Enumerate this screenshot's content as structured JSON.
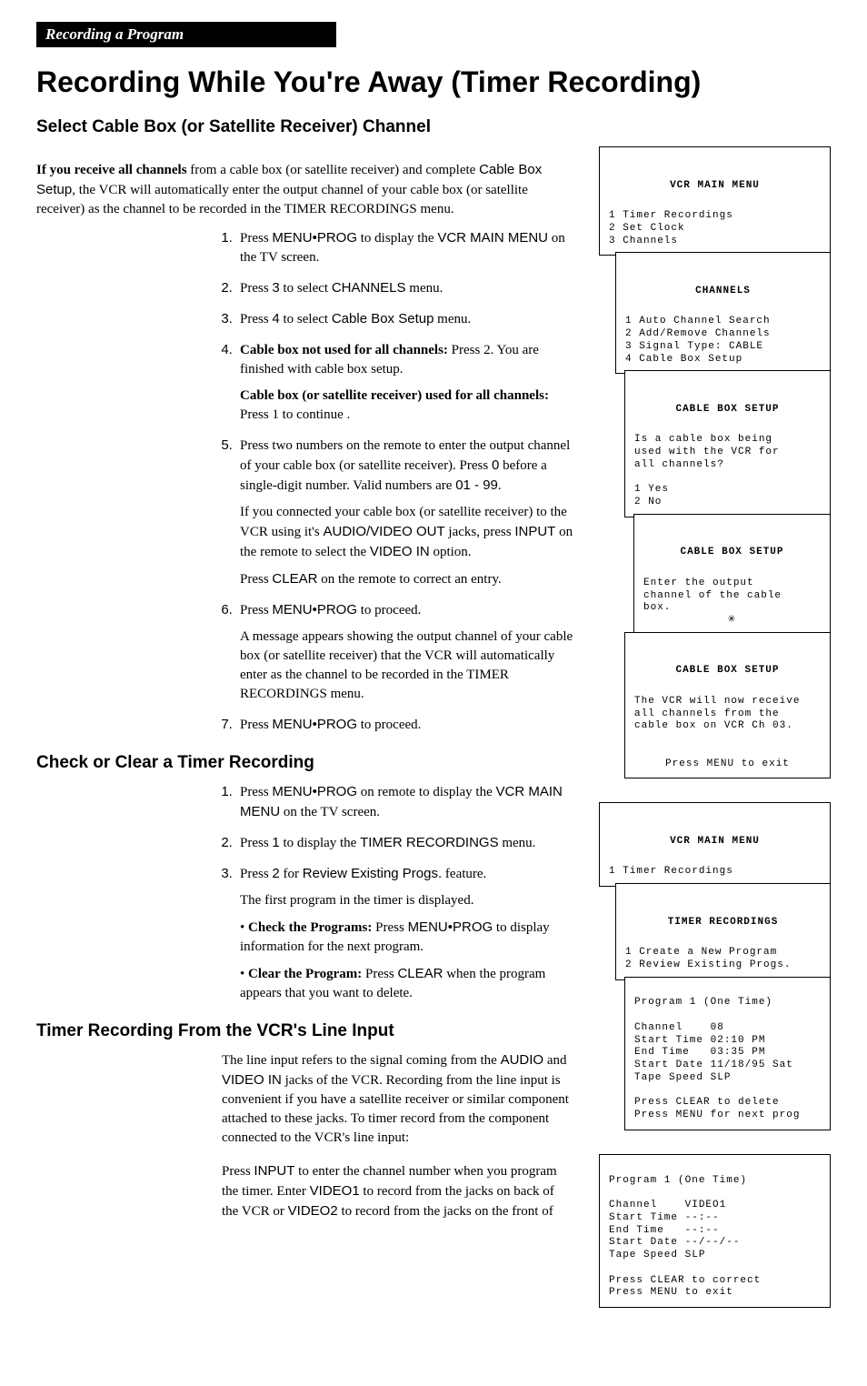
{
  "header_tab": "Recording a Program",
  "page_title": "Recording While You're Away (Timer Recording)",
  "sec1": {
    "heading": "Select Cable Box (or Satellite Receiver) Channel",
    "intro_strong": "If you receive all channels",
    "intro_cont": " from a cable box (or satellite receiver) and complete ",
    "intro_sans": "Cable Box Setup",
    "intro_tail": ", the VCR will automatically enter the output channel of your cable box (or satellite receiver) as the channel to be recorded in the TIMER RECORDINGS menu.",
    "steps": [
      {
        "pre": "Press ",
        "key": "MENU•PROG",
        "mid": " to display the ",
        "key2": "VCR MAIN MENU",
        "tail": " on the TV screen."
      },
      {
        "pre": "Press ",
        "key": "3",
        "mid": " to select ",
        "key2": "CHANNELS",
        "tail": " menu."
      },
      {
        "pre": "Press ",
        "key": "4",
        "mid": " to select ",
        "key2": "Cable Box Setup",
        "tail": " menu."
      },
      {
        "sub": [
          {
            "strong": "Cable box not used for all channels:",
            "t": "  Press 2.  You are finished with cable box setup."
          },
          {
            "strong": "Cable box (or satellite receiver) used for all channels:",
            "t": "  Press 1 to continue ."
          }
        ]
      },
      {
        "pre": "Press two numbers on the remote to enter the output channel of your cable box (or satellite receiver). Press ",
        "key": "0",
        "mid": " before a single-digit number.  Valid numbers are ",
        "key2": "01 - 99",
        "tail": ".",
        "extra": [
          {
            "t": "If you connected your cable box (or satellite receiver) to the VCR using it's ",
            "sans1": "AUDIO/VIDEO OUT",
            "m": " jacks, press ",
            "sans2": "INPUT",
            "m2": " on the remote to select the ",
            "sans3": "VIDEO IN",
            "tail": " option."
          },
          {
            "t": "Press ",
            "sans1": "CLEAR",
            "tail": " on the remote to correct an entry."
          }
        ]
      },
      {
        "pre": "Press ",
        "key": "MENU•PROG",
        "tail": " to proceed.",
        "extra_plain": "A message appears showing the output channel of your cable box (or satellite receiver) that the VCR will automatically enter as the channel to be recorded in the TIMER RECORDINGS menu."
      },
      {
        "pre": "Press ",
        "key": "MENU•PROG",
        "tail": " to proceed."
      }
    ]
  },
  "sec2": {
    "heading": "Check or Clear a Timer Recording",
    "steps": [
      {
        "pre": "Press ",
        "key": "MENU•PROG",
        "mid": " on remote to display the ",
        "key2": "VCR MAIN MENU",
        "tail": " on the TV screen."
      },
      {
        "pre": "Press ",
        "key": "1",
        "mid": " to display the ",
        "key2": "TIMER RECORDINGS",
        "tail": " menu."
      },
      {
        "pre": "Press ",
        "key": "2",
        "mid": " for ",
        "key2": "Review Existing Progs.",
        "tail": " feature.",
        "extra_plain": "The first program in the timer is displayed.",
        "bullets": [
          {
            "strong": "Check the Programs:",
            "t": "  Press ",
            "sans": "MENU•PROG",
            "tail": " to display information for the next program."
          },
          {
            "strong": "Clear the Program:",
            "t": "  Press ",
            "sans": "CLEAR",
            "tail": " when the program appears that you want to delete."
          }
        ]
      }
    ]
  },
  "sec3": {
    "heading": "Timer Recording From the VCR's Line Input",
    "p1": {
      "t": "The line input refers to the signal coming from the ",
      "s1": "AUDIO",
      "m": " and ",
      "s2": "VIDEO IN",
      "tail": " jacks of the VCR.  Recording from the line input is convenient if you have a satellite receiver or similar component attached to these jacks.  To timer record from the component connected to the VCR's line input:"
    },
    "p2": {
      "t": "Press ",
      "s1": "INPUT",
      "m": " to enter the channel number when you program the timer.  Enter ",
      "s2": "VIDEO1",
      "m2": " to record from the jacks on back of the VCR or ",
      "s3": "VIDEO2",
      "tail": " to record from the jacks on the front of"
    }
  },
  "menus": {
    "m1": {
      "title": "VCR MAIN MENU",
      "lines": [
        "1 Timer Recordings",
        "2 Set Clock",
        "3 Channels"
      ]
    },
    "m2": {
      "title": "CHANNELS",
      "lines": [
        "1 Auto Channel Search",
        "2 Add/Remove Channels",
        "3 Signal Type: CABLE",
        "4 Cable Box Setup"
      ]
    },
    "m3": {
      "title": "CABLE BOX SETUP",
      "q": "Is a cable box being\nused with the VCR for\nall channels?",
      "opts": [
        "1 Yes",
        "2 No"
      ]
    },
    "m4": {
      "title": "CABLE BOX SETUP",
      "q": "Enter the output\nchannel of the cable\nbox.",
      "cursor": "✳"
    },
    "m5": {
      "title": "CABLE BOX SETUP",
      "q": "The VCR will now receive\nall channels from the\ncable box on VCR Ch 03.",
      "foot": "Press MENU to exit"
    },
    "m6": {
      "title": "VCR MAIN MENU",
      "lines": [
        "1 Timer Recordings"
      ]
    },
    "m7": {
      "title": "TIMER RECORDINGS",
      "lines": [
        "1 Create a New Program",
        "2 Review Existing Progs."
      ]
    },
    "m8": {
      "title": "Program 1 (One Time)",
      "rows": [
        "Channel    08",
        "Start Time 02:10 PM",
        "End Time   03:35 PM",
        "Start Date 11/18/95 Sat",
        "Tape Speed SLP"
      ],
      "foot": [
        "Press CLEAR to delete",
        "Press MENU for next prog"
      ]
    },
    "m9": {
      "title": "Program 1 (One Time)",
      "rows": [
        "Channel    VIDEO1",
        "Start Time --:--",
        "End Time   --:--",
        "Start Date --/--/--",
        "Tape Speed SLP"
      ],
      "foot": [
        "Press CLEAR to correct",
        "Press MENU to exit"
      ]
    }
  }
}
